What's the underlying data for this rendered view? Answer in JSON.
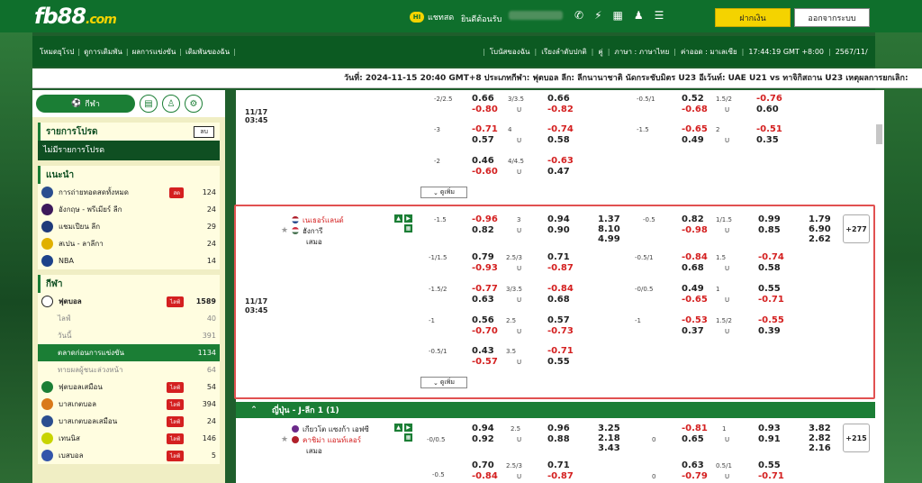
{
  "header": {
    "logo": "fb88",
    "logo_suffix": ".com",
    "chat": "แชทสด",
    "chat_badge": "HI",
    "welcome": "ยินดีต้อนรับ",
    "deposit": "ฝากเงิน",
    "logout": "ออกจากระบบ",
    "icons": [
      "phone-icon",
      "bolt-icon",
      "bank-icon",
      "user-icon",
      "list-icon"
    ]
  },
  "nav": {
    "left": [
      "โหมดยุโรป",
      "ดูการเดิมพัน",
      "ผลการแข่งขัน",
      "เดิมพันของฉัน"
    ],
    "right": [
      "โบนัสของฉัน",
      "เรียงลำดับปกติ",
      "คู่",
      "ภาษา : ภาษาไทย",
      "ค่าออด : มาเลเซีย",
      "17:44:19 GMT +8:00",
      "2567/11/"
    ]
  },
  "ticker": "วันที่: 2024-11-15 20:40 GMT+8 ประเภทกีฬา: ฟุตบอล ลีก: ลีกนานาชาติ นัดกระชับมิตร U23 อีเว้นท์: UAE U21 vs ทาจิกิสถาน U23 เหตุผลการยกเลิก:",
  "sidebar": {
    "sport_btn": "กีฬา",
    "fav_title": "รายการโปรด",
    "fav_btn": "ลบ",
    "fav_empty": "ไม่มีรายการโปรด",
    "rec_title": "แนะนำ",
    "rec": [
      {
        "label": "การถ่ายทอดสดทั้งหมด",
        "badge": "สด",
        "num": "124"
      },
      {
        "label": "อังกฤษ - พรีเมียร์ ลีก",
        "num": "24"
      },
      {
        "label": "แชมเปียน ลีก",
        "num": "29"
      },
      {
        "label": "สเปน - ลาลีกา",
        "num": "24"
      },
      {
        "label": "NBA",
        "num": "14"
      }
    ],
    "sports_title": "กีฬา",
    "football": {
      "label": "ฟุตบอล",
      "badge": "ไลฟ์",
      "num": "1589"
    },
    "subs": [
      {
        "label": "ไลฟ์",
        "num": "40"
      },
      {
        "label": "วันนี้",
        "num": "391"
      },
      {
        "label": "ตลาดก่อนการแข่งขัน",
        "num": "1134",
        "active": true
      },
      {
        "label": "ทายผลผู้ชนะล่วงหน้า",
        "num": "64"
      }
    ],
    "others": [
      {
        "label": "ฟุตบอลเสมือน",
        "badge": "ไลฟ์",
        "num": "54"
      },
      {
        "label": "บาสเกตบอล",
        "badge": "ไลฟ์",
        "num": "394"
      },
      {
        "label": "บาสเกตบอลเสมือน",
        "badge": "ไลฟ์",
        "num": "24"
      },
      {
        "label": "เทนนิส",
        "badge": "ไลฟ์",
        "num": "146"
      },
      {
        "label": "เบสบอล",
        "badge": "ไลฟ์",
        "num": "5"
      }
    ]
  },
  "main": {
    "date1": "11/17",
    "time1": "03:45",
    "date2": "11/17",
    "time2": "03:45",
    "more": "ดูเพิ่ม",
    "top": [
      [
        "-2/2.5",
        "0.66",
        "-0.80",
        "3/3.5",
        "0.66",
        "-0.82",
        "U",
        "-0.5/1",
        "0.52",
        "-0.68",
        "1.5/2",
        "-0.76",
        "0.60",
        "U"
      ],
      [
        "-3",
        "-0.71",
        "0.57",
        "4",
        "-0.74",
        "0.58",
        "U",
        "-1.5",
        "-0.65",
        "0.49",
        "2",
        "-0.51",
        "0.35",
        "U"
      ],
      [
        "-2",
        "0.46",
        "-0.60",
        "4/4.5",
        "-0.63",
        "0.47",
        "U",
        "",
        "",
        "",
        "",
        "",
        "",
        ""
      ]
    ],
    "match1": {
      "home": "เนเธอร์แลนด์",
      "away": "ฮังการี",
      "draw": "เสมอ",
      "hdp": "-1.5",
      "h1": "-0.96",
      "h2": "0.82",
      "ou": "3",
      "o1": "0.94",
      "o2": "0.90",
      "u": "U",
      "x1": "1.37",
      "x2": "8.10",
      "x3": "4.99",
      "fh": "-0.5",
      "f1": "0.82",
      "f2": "-0.98",
      "fou": "1/1.5",
      "fo1": "0.99",
      "fo2": "0.85",
      "fx1": "1.79",
      "fx2": "6.90",
      "fx3": "2.62",
      "plus": "+277"
    },
    "m1rows": [
      [
        "-1/1.5",
        "0.79",
        "-0.93",
        "2.5/3",
        "0.71",
        "-0.87",
        "-0.5/1",
        "-0.84",
        "0.68",
        "1.5",
        "-0.74",
        "0.58"
      ],
      [
        "-1.5/2",
        "-0.77",
        "0.63",
        "3/3.5",
        "-0.84",
        "0.68",
        "-0/0.5",
        "0.49",
        "-0.65",
        "1",
        "0.55",
        "-0.71"
      ],
      [
        "-1",
        "0.56",
        "-0.70",
        "2.5",
        "0.57",
        "-0.73",
        "-1",
        "-0.53",
        "0.37",
        "1.5/2",
        "-0.55",
        "0.39"
      ],
      [
        "-0.5/1",
        "0.43",
        "-0.57",
        "3.5",
        "-0.71",
        "0.55",
        "",
        "",
        "",
        "",
        "",
        ""
      ]
    ],
    "league": "ญี่ปุ่น - J-ลีก 1 (1)",
    "match2": {
      "home": "เกียวโต แซงก้า เอฟซี",
      "away": "คาชิม่า แอนท์เลอร์",
      "draw": "เสมอ",
      "hdp": "-0/0.5",
      "h1": "0.94",
      "h2": "0.92",
      "ou": "2.5",
      "o1": "0.96",
      "o2": "0.88",
      "x1": "3.25",
      "x2": "2.18",
      "x3": "3.43",
      "fh": "0",
      "f1": "-0.81",
      "f2": "0.65",
      "fou": "1",
      "fo1": "0.93",
      "fo2": "0.91",
      "fx1": "3.82",
      "fx2": "2.82",
      "fx3": "2.16",
      "plus": "+215"
    },
    "m2row": [
      "-0.5",
      "0.70",
      "-0.84",
      "2.5/3",
      "0.71",
      "-0.87",
      "0",
      "0.63",
      "-0.79",
      "0.5/1",
      "0.55",
      "-0.71"
    ]
  }
}
